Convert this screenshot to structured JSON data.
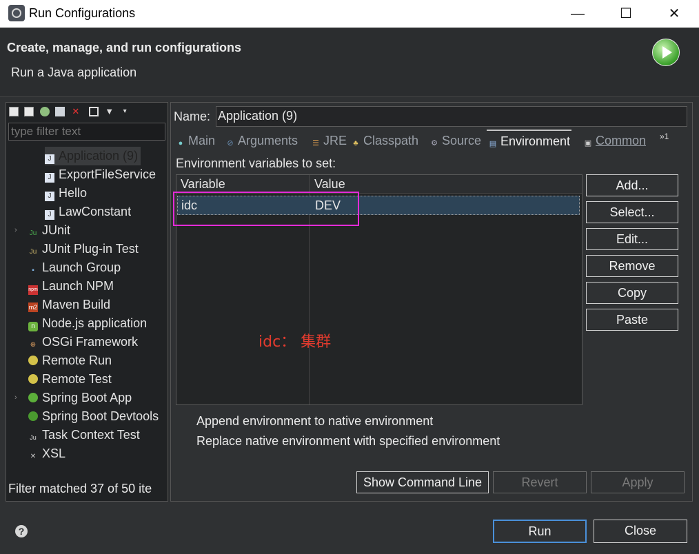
{
  "window": {
    "title": "Run Configurations",
    "min": "—",
    "max": "☐",
    "close": "✕"
  },
  "banner": {
    "heading": "Create, manage, and run configurations",
    "subheading": "Run a Java application"
  },
  "left": {
    "filter_placeholder": "type filter text",
    "toolbar": [
      "new-config-icon",
      "duplicate-icon",
      "new-prototype-icon",
      "export-icon",
      "delete-icon",
      "collapse-all-icon",
      "filter-icon",
      "view-menu-icon"
    ],
    "tree": [
      {
        "label": "Application (9)",
        "selected": true,
        "icon": "java-app-icon"
      },
      {
        "label": "ExportFileService",
        "icon": "java-app-icon"
      },
      {
        "label": "Hello",
        "icon": "java-app-icon"
      },
      {
        "label": "LawConstant",
        "icon": "java-app-icon"
      },
      {
        "label": "JUnit",
        "icon": "junit-icon"
      },
      {
        "label": "JUnit Plug-in Test",
        "icon": "junit-plugin-icon"
      },
      {
        "label": "Launch Group",
        "icon": "launch-group-icon"
      },
      {
        "label": "Launch NPM",
        "icon": "npm-icon"
      },
      {
        "label": "Maven Build",
        "icon": "maven-icon"
      },
      {
        "label": "Node.js application",
        "icon": "nodejs-icon"
      },
      {
        "label": "OSGi Framework",
        "icon": "osgi-icon"
      },
      {
        "label": "Remote Run",
        "icon": "remote-icon"
      },
      {
        "label": "Remote Test",
        "icon": "remote-icon"
      },
      {
        "label": "Spring Boot App",
        "icon": "spring-boot-icon"
      },
      {
        "label": "Spring Boot Devtools",
        "icon": "spring-devtools-icon"
      },
      {
        "label": "Task Context Test",
        "icon": "task-context-icon"
      },
      {
        "label": "XSL",
        "icon": "xsl-icon"
      }
    ],
    "status": "Filter matched 37 of 50 ite"
  },
  "right": {
    "name_label": "Name:",
    "name_value": "Application (9)",
    "tabs": [
      {
        "label": "Main",
        "icon": "main-tab-icon"
      },
      {
        "label": "Arguments",
        "icon": "arguments-tab-icon"
      },
      {
        "label": "JRE",
        "icon": "jre-tab-icon"
      },
      {
        "label": "Classpath",
        "icon": "classpath-tab-icon"
      },
      {
        "label": "Source",
        "icon": "source-tab-icon"
      },
      {
        "label": "Environment",
        "icon": "environment-tab-icon",
        "active": true
      },
      {
        "label": "Common",
        "icon": "common-tab-icon"
      }
    ],
    "tab_overflow": "»1",
    "env_label": "Environment variables to set:",
    "table": {
      "headers": [
        "Variable",
        "Value"
      ],
      "rows": [
        {
          "variable": "idc",
          "value": "DEV"
        }
      ]
    },
    "annotation": "idc： 集群",
    "buttons": {
      "add": "Add...",
      "select": "Select...",
      "edit": "Edit...",
      "remove": "Remove",
      "copy": "Copy",
      "paste": "Paste"
    },
    "radio_append": "Append environment to native environment",
    "radio_replace": "Replace native environment with specified environment",
    "show_command_line": "Show Command Line",
    "revert": "Revert",
    "apply": "Apply"
  },
  "footer": {
    "help": "?",
    "run": "Run",
    "close": "Close"
  },
  "colors": {
    "annotation": "#e23b2e",
    "highlight": "#e52bd8",
    "selected_row": "#2d4457"
  }
}
